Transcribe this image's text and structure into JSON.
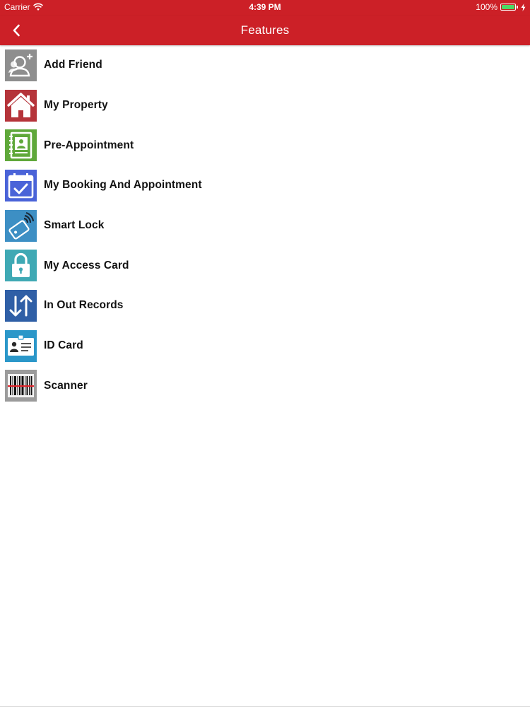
{
  "status_bar": {
    "carrier": "Carrier",
    "time": "4:39 PM",
    "battery": "100%",
    "battery_level": 1.0,
    "icons": [
      "wifi-icon",
      "battery-icon",
      "charging-bolt-icon"
    ]
  },
  "nav": {
    "title": "Features",
    "back_icon": "chevron-left-icon",
    "bar_color": "#cc2027"
  },
  "features": [
    {
      "label": "Add Friend",
      "icon": "add-friend-icon",
      "color": "#8e8e8e"
    },
    {
      "label": "My Property",
      "icon": "house-icon",
      "color": "#b5343a"
    },
    {
      "label": "Pre-Appointment",
      "icon": "address-book-icon",
      "color": "#5fa83a"
    },
    {
      "label": "My Booking And Appointment",
      "icon": "calendar-check-icon",
      "color": "#4a63d8"
    },
    {
      "label": "Smart Lock",
      "icon": "nfc-card-icon",
      "color": "#3d8fc4"
    },
    {
      "label": "My Access Card",
      "icon": "padlock-icon",
      "color": "#3fa9b4"
    },
    {
      "label": "In Out Records",
      "icon": "in-out-arrows-icon",
      "color": "#2f5fa6"
    },
    {
      "label": "ID Card",
      "icon": "id-card-icon",
      "color": "#2b97c9"
    },
    {
      "label": "Scanner",
      "icon": "barcode-scanner-icon",
      "color": "#9b9b9b"
    }
  ]
}
